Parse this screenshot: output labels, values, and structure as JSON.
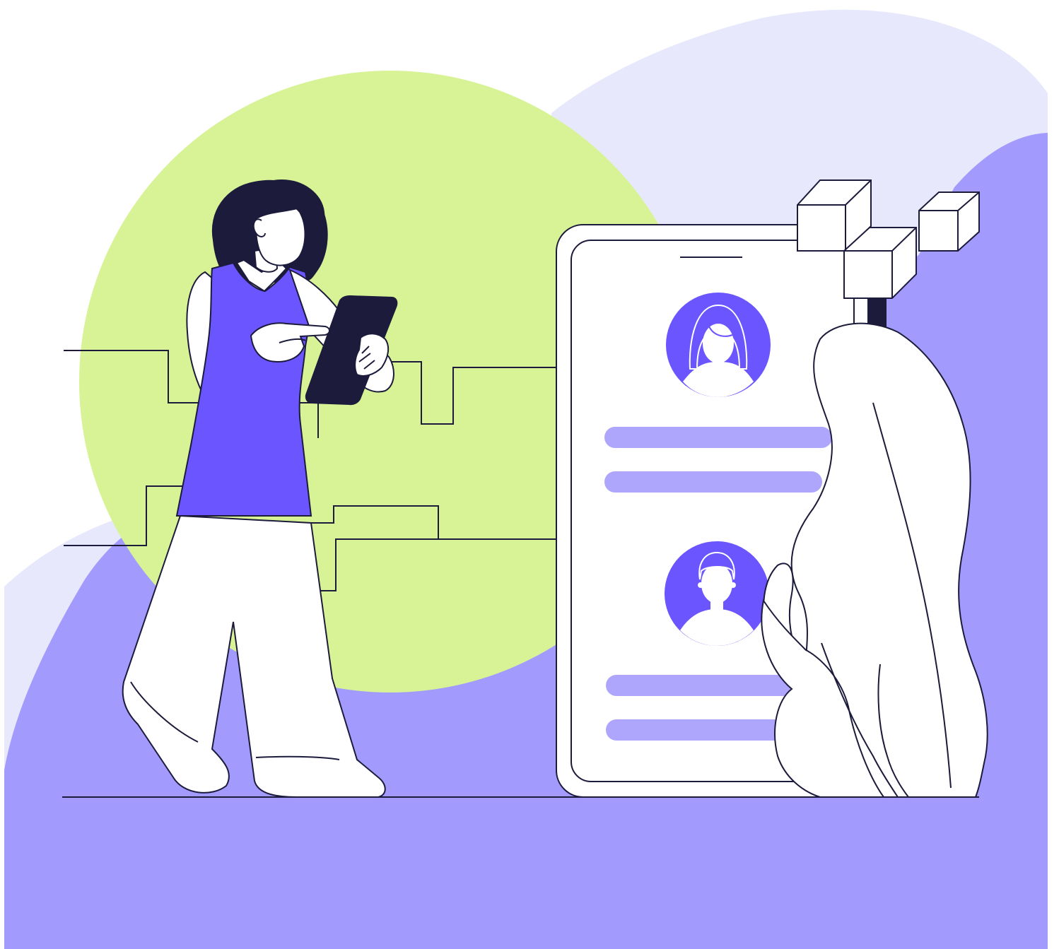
{
  "illustration": {
    "colors": {
      "background": "#ffffff",
      "blob_light": "#e8e8fd",
      "blob_main": "#a29bfd",
      "circle": "#d7f396",
      "accent": "#6b55fe",
      "bar": "#aea6fd",
      "ink": "#1c1b3b",
      "white": "#ffffff"
    },
    "icons": [
      "person-icon",
      "tablet-icon",
      "phone-icon",
      "female-avatar-icon",
      "male-avatar-icon",
      "cube-icon",
      "leaf-icon"
    ]
  }
}
